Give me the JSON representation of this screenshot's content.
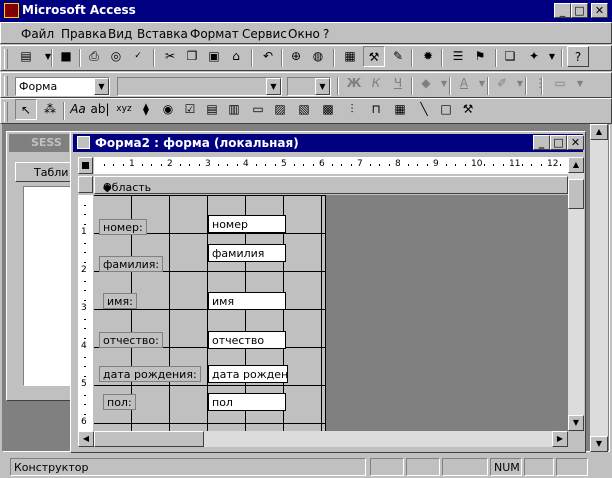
{
  "app": {
    "title": "Microsoft Access"
  },
  "menu": [
    "Файл",
    "Правка",
    "Вид",
    "Вставка",
    "Формат",
    "Сервис",
    "Окно",
    "?"
  ],
  "formatting": {
    "object_combo": "Форма",
    "font_combo": "",
    "size_combo": ""
  },
  "db_window": {
    "title": "SESS :",
    "tab_label": "Табли"
  },
  "form_window": {
    "title": "Форма2 : форма (локальная)",
    "section_label": "Область данных",
    "ruler_h": [
      "1",
      "2",
      "3",
      "4",
      "5",
      "6",
      "7",
      "8",
      "9",
      "10",
      "11",
      "12"
    ],
    "ruler_v": [
      "1",
      "2",
      "3",
      "4",
      "5",
      "6"
    ],
    "fields": [
      {
        "label": "номер:",
        "control": "номер"
      },
      {
        "label": "фамилия:",
        "control": "фамилия"
      },
      {
        "label": "имя:",
        "control": "имя"
      },
      {
        "label": "отчество:",
        "control": "отчество"
      },
      {
        "label": "дата рождения:",
        "control": "дата рождения"
      },
      {
        "label": "пол:",
        "control": "пол"
      }
    ]
  },
  "status": {
    "mode": "Конструктор",
    "num": "NUM"
  },
  "icons": {
    "standard_toolbar": [
      "view-icon",
      "save-icon",
      "print-icon",
      "print-preview-icon",
      "spelling-icon",
      "cut-icon",
      "copy-icon",
      "paste-icon",
      "format-painter-icon",
      "undo-icon",
      "insert-hyperlink-icon",
      "web-toolbar-icon",
      "field-list-icon",
      "toolbox-icon",
      "autoformat-icon",
      "code-icon",
      "properties-icon",
      "build-icon",
      "database-window-icon",
      "new-object-icon",
      "help-icon"
    ],
    "toolbox": [
      "select-objects-icon",
      "control-wizards-icon",
      "label-tool-icon",
      "textbox-tool-icon",
      "option-group-icon",
      "toggle-button-icon",
      "option-button-icon",
      "checkbox-tool-icon",
      "combobox-tool-icon",
      "listbox-tool-icon",
      "command-button-icon",
      "image-tool-icon",
      "unbound-object-icon",
      "bound-object-icon",
      "page-break-icon",
      "tab-control-icon",
      "subform-icon",
      "line-tool-icon",
      "rectangle-tool-icon",
      "more-controls-icon"
    ]
  },
  "colors": {
    "titlebar": "#000080",
    "face": "#c0c0c0",
    "workspace": "#808080"
  }
}
